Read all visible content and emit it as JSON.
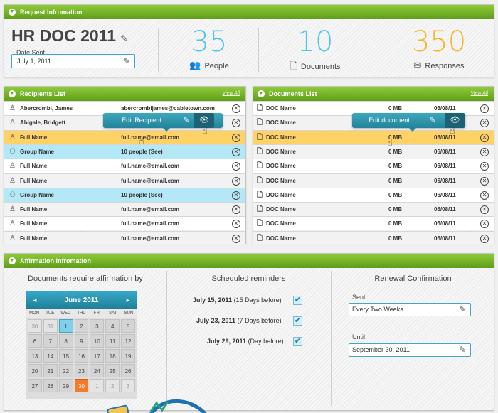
{
  "request": {
    "header": "Request Infromation",
    "doc_title": "HR DOC 2011",
    "date_label": "Date Sent",
    "date_value": "July 1, 2011",
    "stats": [
      {
        "value": "35",
        "label": "People",
        "color": "#4fc6e8",
        "icon": "people-icon"
      },
      {
        "value": "10",
        "label": "Documents",
        "color": "#4fc6e8",
        "icon": "document-icon"
      },
      {
        "value": "350",
        "label": "Responses",
        "color": "#f7b529",
        "icon": "envelope-icon"
      }
    ]
  },
  "recipients": {
    "header": "Recipients List",
    "view_all": "View All",
    "tooltip": "Edit Recipient",
    "rows": [
      {
        "name": "Abercrombi, James",
        "value": "abercrombijames@cabletown.com",
        "type": "person"
      },
      {
        "name": "Abigale, Bridgett",
        "value": "",
        "type": "person"
      },
      {
        "name": "Full Name",
        "value": "full.name@email.com",
        "type": "person"
      },
      {
        "name": "Group Name",
        "value": "10 people (See)",
        "type": "group"
      },
      {
        "name": "Full Name",
        "value": "full.name@email.com",
        "type": "person"
      },
      {
        "name": "Full Name",
        "value": "full.name@email.com",
        "type": "person"
      },
      {
        "name": "Group Name",
        "value": "10 people (See)",
        "type": "group"
      },
      {
        "name": "Full Name",
        "value": "full.name@email.com",
        "type": "person"
      },
      {
        "name": "Full Name",
        "value": "full.name@email.com",
        "type": "person"
      },
      {
        "name": "Full Name",
        "value": "full.name@email.com",
        "type": "person"
      }
    ]
  },
  "documents": {
    "header": "Documents List",
    "view_all": "View All",
    "tooltip": "Edit document",
    "rows": [
      {
        "name": "DOC Name",
        "size": "0 MB",
        "date": "06/08/11"
      },
      {
        "name": "DOC Name",
        "size": "",
        "date": ""
      },
      {
        "name": "DOC Name",
        "size": "0 MB",
        "date": "06/08/11"
      },
      {
        "name": "DOC Name",
        "size": "0 MB",
        "date": "06/08/11"
      },
      {
        "name": "DOC Name",
        "size": "0 MB",
        "date": "06/08/11"
      },
      {
        "name": "DOC Name",
        "size": "0 MB",
        "date": "06/08/11"
      },
      {
        "name": "DOC Name",
        "size": "0 MB",
        "date": "06/08/11"
      },
      {
        "name": "DOC Name",
        "size": "0 MB",
        "date": "06/08/11"
      },
      {
        "name": "DOC Name",
        "size": "0 MB",
        "date": "06/08/11"
      },
      {
        "name": "DOC Name",
        "size": "0 MB",
        "date": "06/08/11"
      }
    ]
  },
  "affirmation": {
    "header": "Affirmation Infromation",
    "calendar_title": "Documents require affirmation by",
    "calendar": {
      "month": "June 2011",
      "prev": "◄",
      "next": "►",
      "dow": [
        "MON",
        "TUE",
        "WED",
        "THU",
        "FRI",
        "SAT",
        "SUN"
      ],
      "days": [
        {
          "d": "30",
          "m": true
        },
        {
          "d": "31",
          "m": true
        },
        {
          "d": "1",
          "t": true
        },
        {
          "d": "2"
        },
        {
          "d": "3"
        },
        {
          "d": "4"
        },
        {
          "d": "5"
        },
        {
          "d": "6"
        },
        {
          "d": "7"
        },
        {
          "d": "8"
        },
        {
          "d": "9"
        },
        {
          "d": "10"
        },
        {
          "d": "11"
        },
        {
          "d": "12"
        },
        {
          "d": "13"
        },
        {
          "d": "14"
        },
        {
          "d": "15"
        },
        {
          "d": "16"
        },
        {
          "d": "17"
        },
        {
          "d": "18"
        },
        {
          "d": "19"
        },
        {
          "d": "20"
        },
        {
          "d": "21"
        },
        {
          "d": "22"
        },
        {
          "d": "23"
        },
        {
          "d": "24"
        },
        {
          "d": "25"
        },
        {
          "d": "26"
        },
        {
          "d": "27"
        },
        {
          "d": "28"
        },
        {
          "d": "29"
        },
        {
          "d": "30",
          "s": true
        },
        {
          "d": "1",
          "m": true
        },
        {
          "d": "2",
          "m": true
        },
        {
          "d": "3",
          "m": true
        }
      ]
    },
    "reminders_title": "Scheduled reminders",
    "reminders": [
      {
        "date": "July 15, 2011",
        "note": "(15 Days before)",
        "checked": true
      },
      {
        "date": "July 23, 2011",
        "note": "(7 Days before)",
        "checked": true
      },
      {
        "date": "July 29, 2011",
        "note": "(Day before)",
        "checked": true
      }
    ],
    "renewal_title": "Renewal Confirmation",
    "sent_label": "Sent",
    "sent_value": "Every Two Weeks",
    "until_label": "Until",
    "until_value": "September 30, 2011"
  }
}
